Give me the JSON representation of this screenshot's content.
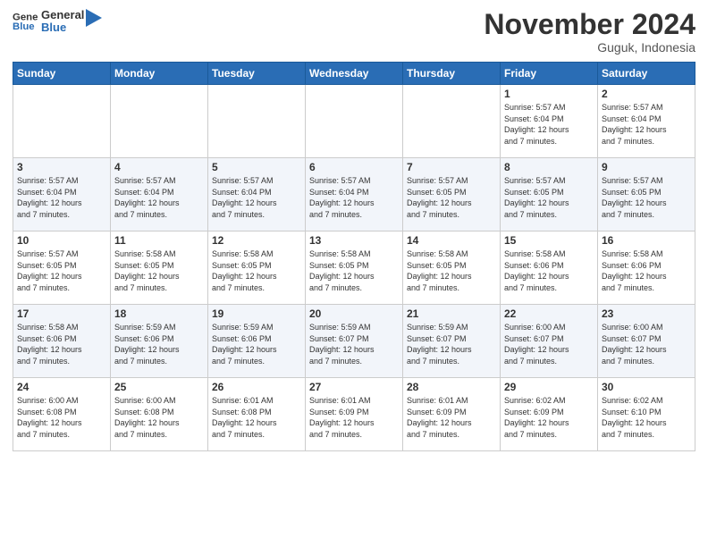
{
  "logo": {
    "line1": "General",
    "line2": "Blue"
  },
  "header": {
    "month": "November 2024",
    "location": "Guguk, Indonesia"
  },
  "weekdays": [
    "Sunday",
    "Monday",
    "Tuesday",
    "Wednesday",
    "Thursday",
    "Friday",
    "Saturday"
  ],
  "weeks": [
    [
      {
        "day": "",
        "info": ""
      },
      {
        "day": "",
        "info": ""
      },
      {
        "day": "",
        "info": ""
      },
      {
        "day": "",
        "info": ""
      },
      {
        "day": "",
        "info": ""
      },
      {
        "day": "1",
        "info": "Sunrise: 5:57 AM\nSunset: 6:04 PM\nDaylight: 12 hours\nand 7 minutes."
      },
      {
        "day": "2",
        "info": "Sunrise: 5:57 AM\nSunset: 6:04 PM\nDaylight: 12 hours\nand 7 minutes."
      }
    ],
    [
      {
        "day": "3",
        "info": "Sunrise: 5:57 AM\nSunset: 6:04 PM\nDaylight: 12 hours\nand 7 minutes."
      },
      {
        "day": "4",
        "info": "Sunrise: 5:57 AM\nSunset: 6:04 PM\nDaylight: 12 hours\nand 7 minutes."
      },
      {
        "day": "5",
        "info": "Sunrise: 5:57 AM\nSunset: 6:04 PM\nDaylight: 12 hours\nand 7 minutes."
      },
      {
        "day": "6",
        "info": "Sunrise: 5:57 AM\nSunset: 6:04 PM\nDaylight: 12 hours\nand 7 minutes."
      },
      {
        "day": "7",
        "info": "Sunrise: 5:57 AM\nSunset: 6:05 PM\nDaylight: 12 hours\nand 7 minutes."
      },
      {
        "day": "8",
        "info": "Sunrise: 5:57 AM\nSunset: 6:05 PM\nDaylight: 12 hours\nand 7 minutes."
      },
      {
        "day": "9",
        "info": "Sunrise: 5:57 AM\nSunset: 6:05 PM\nDaylight: 12 hours\nand 7 minutes."
      }
    ],
    [
      {
        "day": "10",
        "info": "Sunrise: 5:57 AM\nSunset: 6:05 PM\nDaylight: 12 hours\nand 7 minutes."
      },
      {
        "day": "11",
        "info": "Sunrise: 5:58 AM\nSunset: 6:05 PM\nDaylight: 12 hours\nand 7 minutes."
      },
      {
        "day": "12",
        "info": "Sunrise: 5:58 AM\nSunset: 6:05 PM\nDaylight: 12 hours\nand 7 minutes."
      },
      {
        "day": "13",
        "info": "Sunrise: 5:58 AM\nSunset: 6:05 PM\nDaylight: 12 hours\nand 7 minutes."
      },
      {
        "day": "14",
        "info": "Sunrise: 5:58 AM\nSunset: 6:05 PM\nDaylight: 12 hours\nand 7 minutes."
      },
      {
        "day": "15",
        "info": "Sunrise: 5:58 AM\nSunset: 6:06 PM\nDaylight: 12 hours\nand 7 minutes."
      },
      {
        "day": "16",
        "info": "Sunrise: 5:58 AM\nSunset: 6:06 PM\nDaylight: 12 hours\nand 7 minutes."
      }
    ],
    [
      {
        "day": "17",
        "info": "Sunrise: 5:58 AM\nSunset: 6:06 PM\nDaylight: 12 hours\nand 7 minutes."
      },
      {
        "day": "18",
        "info": "Sunrise: 5:59 AM\nSunset: 6:06 PM\nDaylight: 12 hours\nand 7 minutes."
      },
      {
        "day": "19",
        "info": "Sunrise: 5:59 AM\nSunset: 6:06 PM\nDaylight: 12 hours\nand 7 minutes."
      },
      {
        "day": "20",
        "info": "Sunrise: 5:59 AM\nSunset: 6:07 PM\nDaylight: 12 hours\nand 7 minutes."
      },
      {
        "day": "21",
        "info": "Sunrise: 5:59 AM\nSunset: 6:07 PM\nDaylight: 12 hours\nand 7 minutes."
      },
      {
        "day": "22",
        "info": "Sunrise: 6:00 AM\nSunset: 6:07 PM\nDaylight: 12 hours\nand 7 minutes."
      },
      {
        "day": "23",
        "info": "Sunrise: 6:00 AM\nSunset: 6:07 PM\nDaylight: 12 hours\nand 7 minutes."
      }
    ],
    [
      {
        "day": "24",
        "info": "Sunrise: 6:00 AM\nSunset: 6:08 PM\nDaylight: 12 hours\nand 7 minutes."
      },
      {
        "day": "25",
        "info": "Sunrise: 6:00 AM\nSunset: 6:08 PM\nDaylight: 12 hours\nand 7 minutes."
      },
      {
        "day": "26",
        "info": "Sunrise: 6:01 AM\nSunset: 6:08 PM\nDaylight: 12 hours\nand 7 minutes."
      },
      {
        "day": "27",
        "info": "Sunrise: 6:01 AM\nSunset: 6:09 PM\nDaylight: 12 hours\nand 7 minutes."
      },
      {
        "day": "28",
        "info": "Sunrise: 6:01 AM\nSunset: 6:09 PM\nDaylight: 12 hours\nand 7 minutes."
      },
      {
        "day": "29",
        "info": "Sunrise: 6:02 AM\nSunset: 6:09 PM\nDaylight: 12 hours\nand 7 minutes."
      },
      {
        "day": "30",
        "info": "Sunrise: 6:02 AM\nSunset: 6:10 PM\nDaylight: 12 hours\nand 7 minutes."
      }
    ]
  ]
}
